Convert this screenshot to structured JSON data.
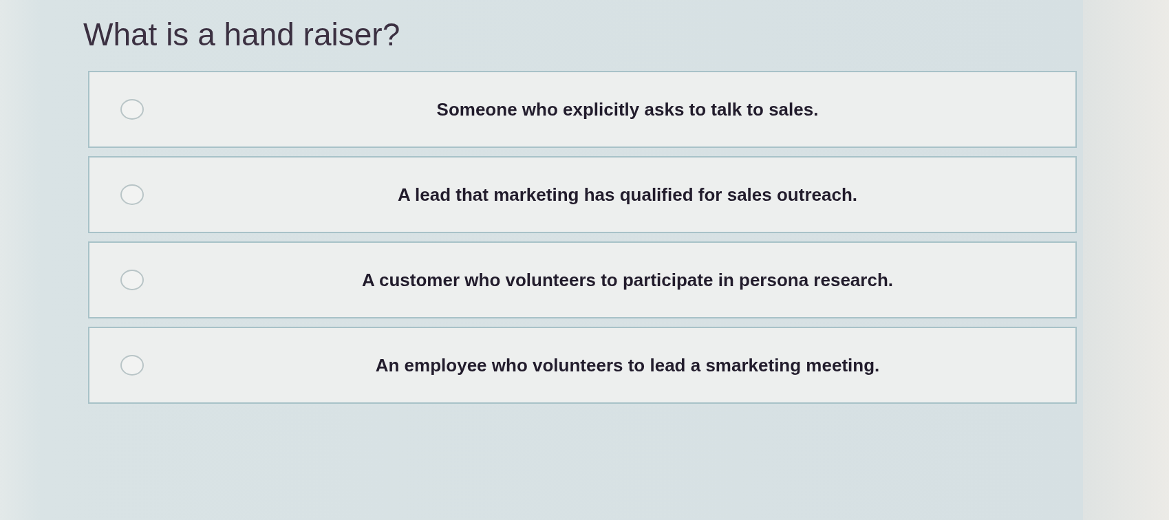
{
  "question": {
    "text": "What is a hand raiser?"
  },
  "options": [
    {
      "text": "Someone who explicitly asks to talk to sales.",
      "selected": false
    },
    {
      "text": "A lead that marketing has qualified for sales outreach.",
      "selected": false
    },
    {
      "text": "A customer who volunteers to participate in persona research.",
      "selected": false
    },
    {
      "text": "An employee who volunteers to lead a smarketing meeting.",
      "selected": false
    }
  ]
}
